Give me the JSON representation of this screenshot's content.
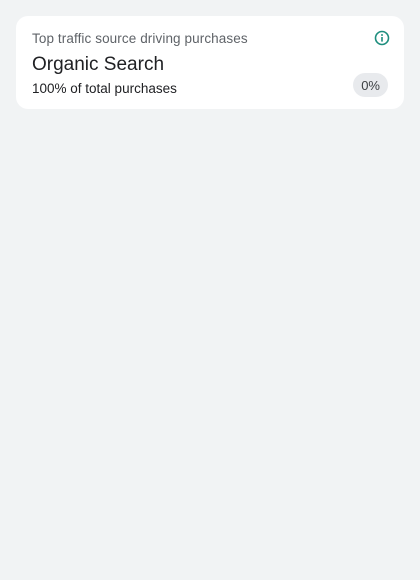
{
  "card": {
    "title": "Top traffic source driving purchases",
    "value": "Organic Search",
    "subtitle": "100% of total purchases",
    "change_badge": "0%",
    "info_icon": "info-icon",
    "accent_color": "#1e8e7e"
  }
}
